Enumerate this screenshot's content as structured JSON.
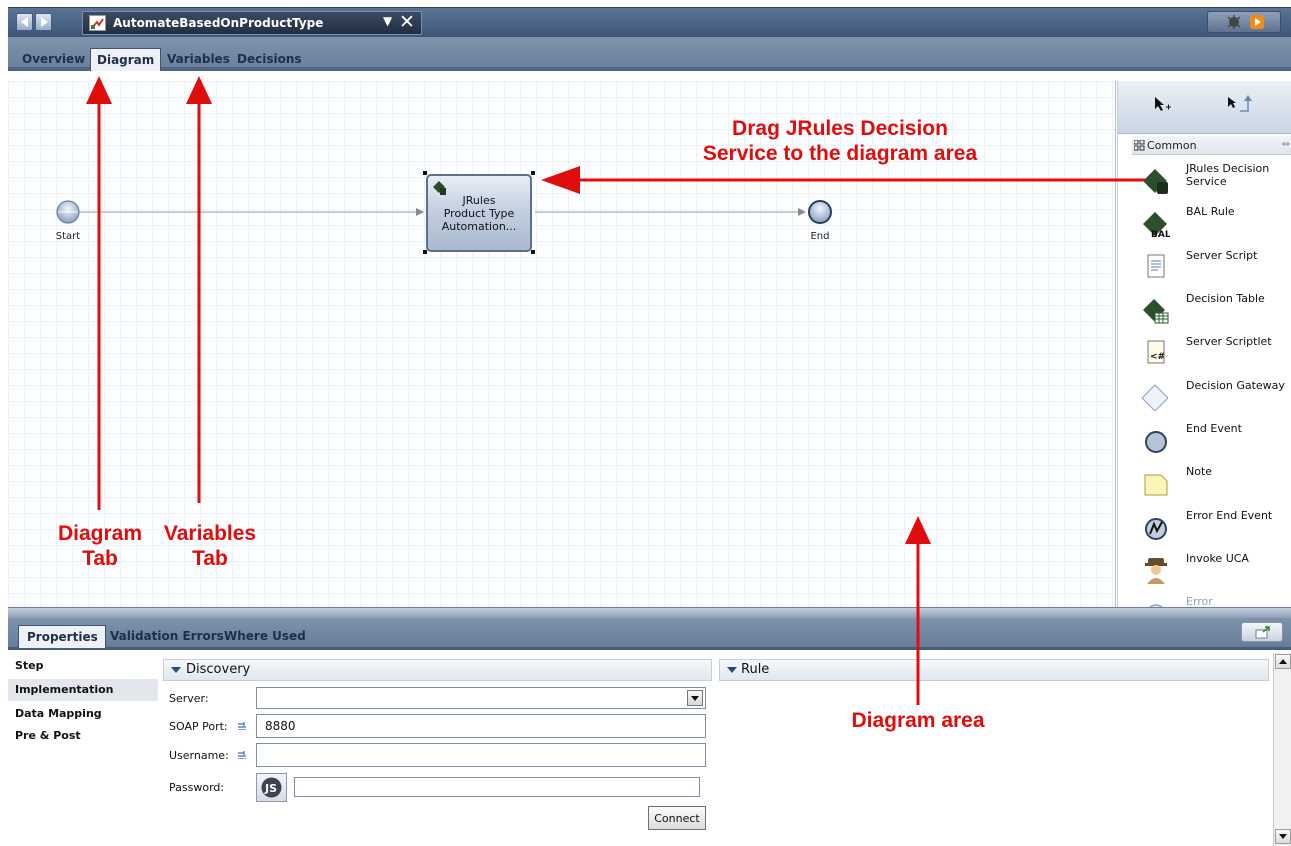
{
  "window": {
    "document_title": "AutomateBasedOnProductType"
  },
  "tabs": [
    {
      "label": "Overview"
    },
    {
      "label": "Diagram"
    },
    {
      "label": "Variables"
    },
    {
      "label": "Decisions"
    }
  ],
  "diagram": {
    "start_label": "Start",
    "end_label": "End",
    "activity_lines": [
      "JRules",
      "Product Type",
      "Automation..."
    ]
  },
  "palette": {
    "section": "Common",
    "items": [
      {
        "label": "JRules Decision Service",
        "icon": "jrules-decision-service-icon"
      },
      {
        "label": "BAL Rule",
        "icon": "bal-rule-icon"
      },
      {
        "label": "Server Script",
        "icon": "server-script-icon"
      },
      {
        "label": "Decision Table",
        "icon": "decision-table-icon"
      },
      {
        "label": "Server Scriptlet",
        "icon": "server-scriptlet-icon"
      },
      {
        "label": "Decision Gateway",
        "icon": "decision-gateway-icon"
      },
      {
        "label": "End Event",
        "icon": "end-event-icon"
      },
      {
        "label": "Note",
        "icon": "note-icon"
      },
      {
        "label": "Error End Event",
        "icon": "error-end-event-icon"
      },
      {
        "label": "Invoke UCA",
        "icon": "invoke-uca-icon"
      },
      {
        "label": "Error Intermediate",
        "icon": "error-intermediate-icon"
      }
    ]
  },
  "properties": {
    "tabs": [
      {
        "label": "Properties"
      },
      {
        "label": "Validation Errors"
      },
      {
        "label": "Where Used"
      }
    ],
    "side_items": [
      {
        "label": "Step"
      },
      {
        "label": "Implementation"
      },
      {
        "label": "Data Mapping"
      },
      {
        "label": "Pre & Post"
      }
    ],
    "discovery": {
      "title": "Discovery",
      "server_label": "Server:",
      "server_value": "",
      "soap_port_label": "SOAP Port:",
      "soap_port_value": "8880",
      "username_label": "Username:",
      "username_value": "",
      "password_label": "Password:",
      "password_value": "",
      "js_label": "JS",
      "connect_label": "Connect"
    },
    "rule": {
      "title": "Rule"
    }
  },
  "annotations": {
    "drag_line1": "Drag JRules Decision",
    "drag_line2": "Service to the diagram area",
    "diagram_tab_line1": "Diagram",
    "diagram_tab_line2": "Tab",
    "variables_tab_line1": "Variables",
    "variables_tab_line2": "Tab",
    "diagram_area": "Diagram area"
  },
  "colors": {
    "annotation_red": "#e00d0d",
    "toolbar_blue": "#5b7496"
  }
}
